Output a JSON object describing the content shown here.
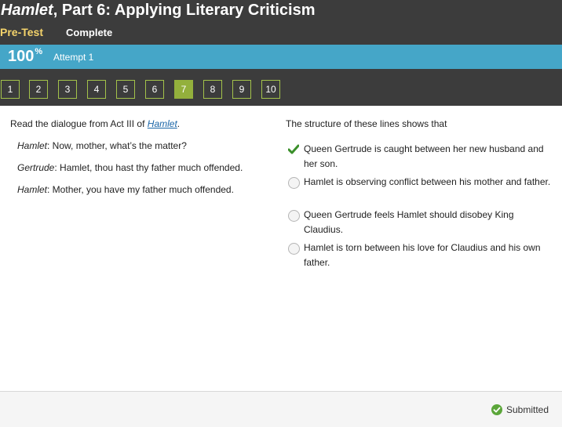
{
  "header": {
    "title_italic": "Hamlet",
    "title_rest": ", Part 6: Applying Literary Criticism",
    "pretest_label": "Pre-Test",
    "status_label": "Complete"
  },
  "progress": {
    "percent": "100",
    "percent_sign": "%",
    "attempt_label": "Attempt 1",
    "accent_color": "#45a6c8"
  },
  "question_nav": {
    "items": [
      "1",
      "2",
      "3",
      "4",
      "5",
      "6",
      "7",
      "8",
      "9",
      "10"
    ],
    "current": "7",
    "accent_color": "#93b03c"
  },
  "passage": {
    "lead_text": "Read the dialogue from Act III of ",
    "lead_link": "Hamlet",
    "lead_end": ".",
    "lines": [
      {
        "speaker": "Hamlet",
        "text": ": Now, mother, what’s the matter?"
      },
      {
        "speaker": "Gertrude",
        "text": ": Hamlet, thou hast thy father much offended."
      },
      {
        "speaker": "Hamlet",
        "text": ": Mother, you have my father much offended."
      }
    ]
  },
  "question": {
    "stem": "The structure of these lines shows that",
    "options": [
      {
        "text": " Queen Gertrude is caught between her new husband and her son.",
        "selected": true
      },
      {
        "text": " Hamlet is observing conflict between his mother and father.",
        "selected": false
      },
      {
        "text": " Queen Gertrude feels Hamlet should disobey King Claudius.",
        "selected": false
      },
      {
        "text": " Hamlet is torn between his love for Claudius and his own father.",
        "selected": false
      }
    ]
  },
  "footer": {
    "status_label": "Submitted"
  }
}
